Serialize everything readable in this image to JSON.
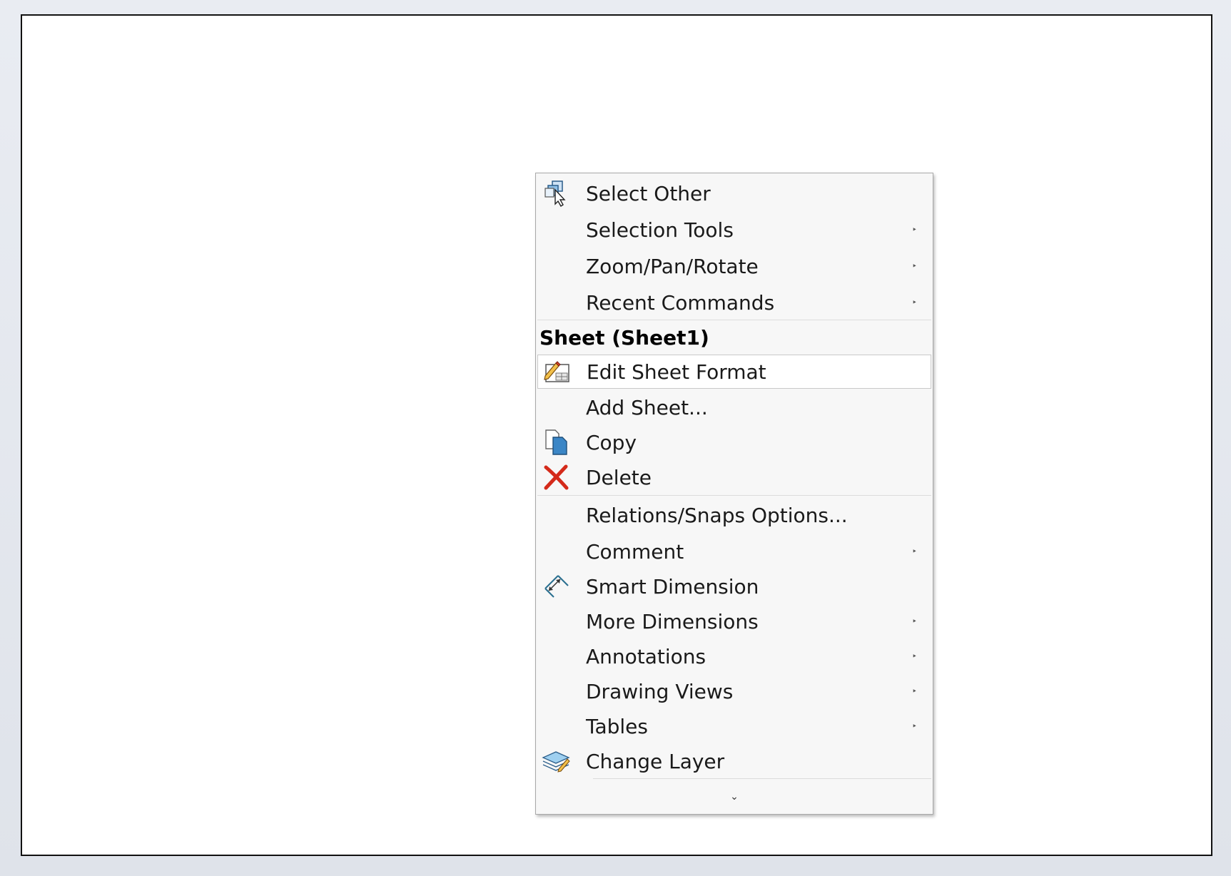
{
  "menu": {
    "items_top": [
      {
        "label": "Select Other",
        "icon": "select-other-icon",
        "submenu": false
      },
      {
        "label": "Selection Tools",
        "icon": "",
        "submenu": true
      },
      {
        "label": "Zoom/Pan/Rotate",
        "icon": "",
        "submenu": true
      },
      {
        "label": "Recent Commands",
        "icon": "",
        "submenu": true
      }
    ],
    "section_header": "Sheet (Sheet1)",
    "items_sheet": [
      {
        "label": "Edit Sheet Format",
        "icon": "edit-sheet-format-icon",
        "submenu": false,
        "highlighted": true
      },
      {
        "label": "Add Sheet...",
        "icon": "",
        "submenu": false
      },
      {
        "label": "Copy",
        "icon": "copy-icon",
        "submenu": false
      },
      {
        "label": "Delete",
        "icon": "delete-icon",
        "submenu": false
      }
    ],
    "items_bottom": [
      {
        "label": "Relations/Snaps Options...",
        "icon": "",
        "submenu": false
      },
      {
        "label": "Comment",
        "icon": "",
        "submenu": true
      },
      {
        "label": "Smart Dimension",
        "icon": "smart-dimension-icon",
        "submenu": false
      },
      {
        "label": "More Dimensions",
        "icon": "",
        "submenu": true
      },
      {
        "label": "Annotations",
        "icon": "",
        "submenu": true
      },
      {
        "label": "Drawing Views",
        "icon": "",
        "submenu": true
      },
      {
        "label": "Tables",
        "icon": "",
        "submenu": true
      },
      {
        "label": "Change Layer",
        "icon": "change-layer-icon",
        "submenu": false
      }
    ],
    "submenu_glyph": "‣",
    "expand_glyph": "⌄",
    "colors": {
      "delete_red": "#d42a1a",
      "icon_blue": "#3b86c6"
    }
  }
}
